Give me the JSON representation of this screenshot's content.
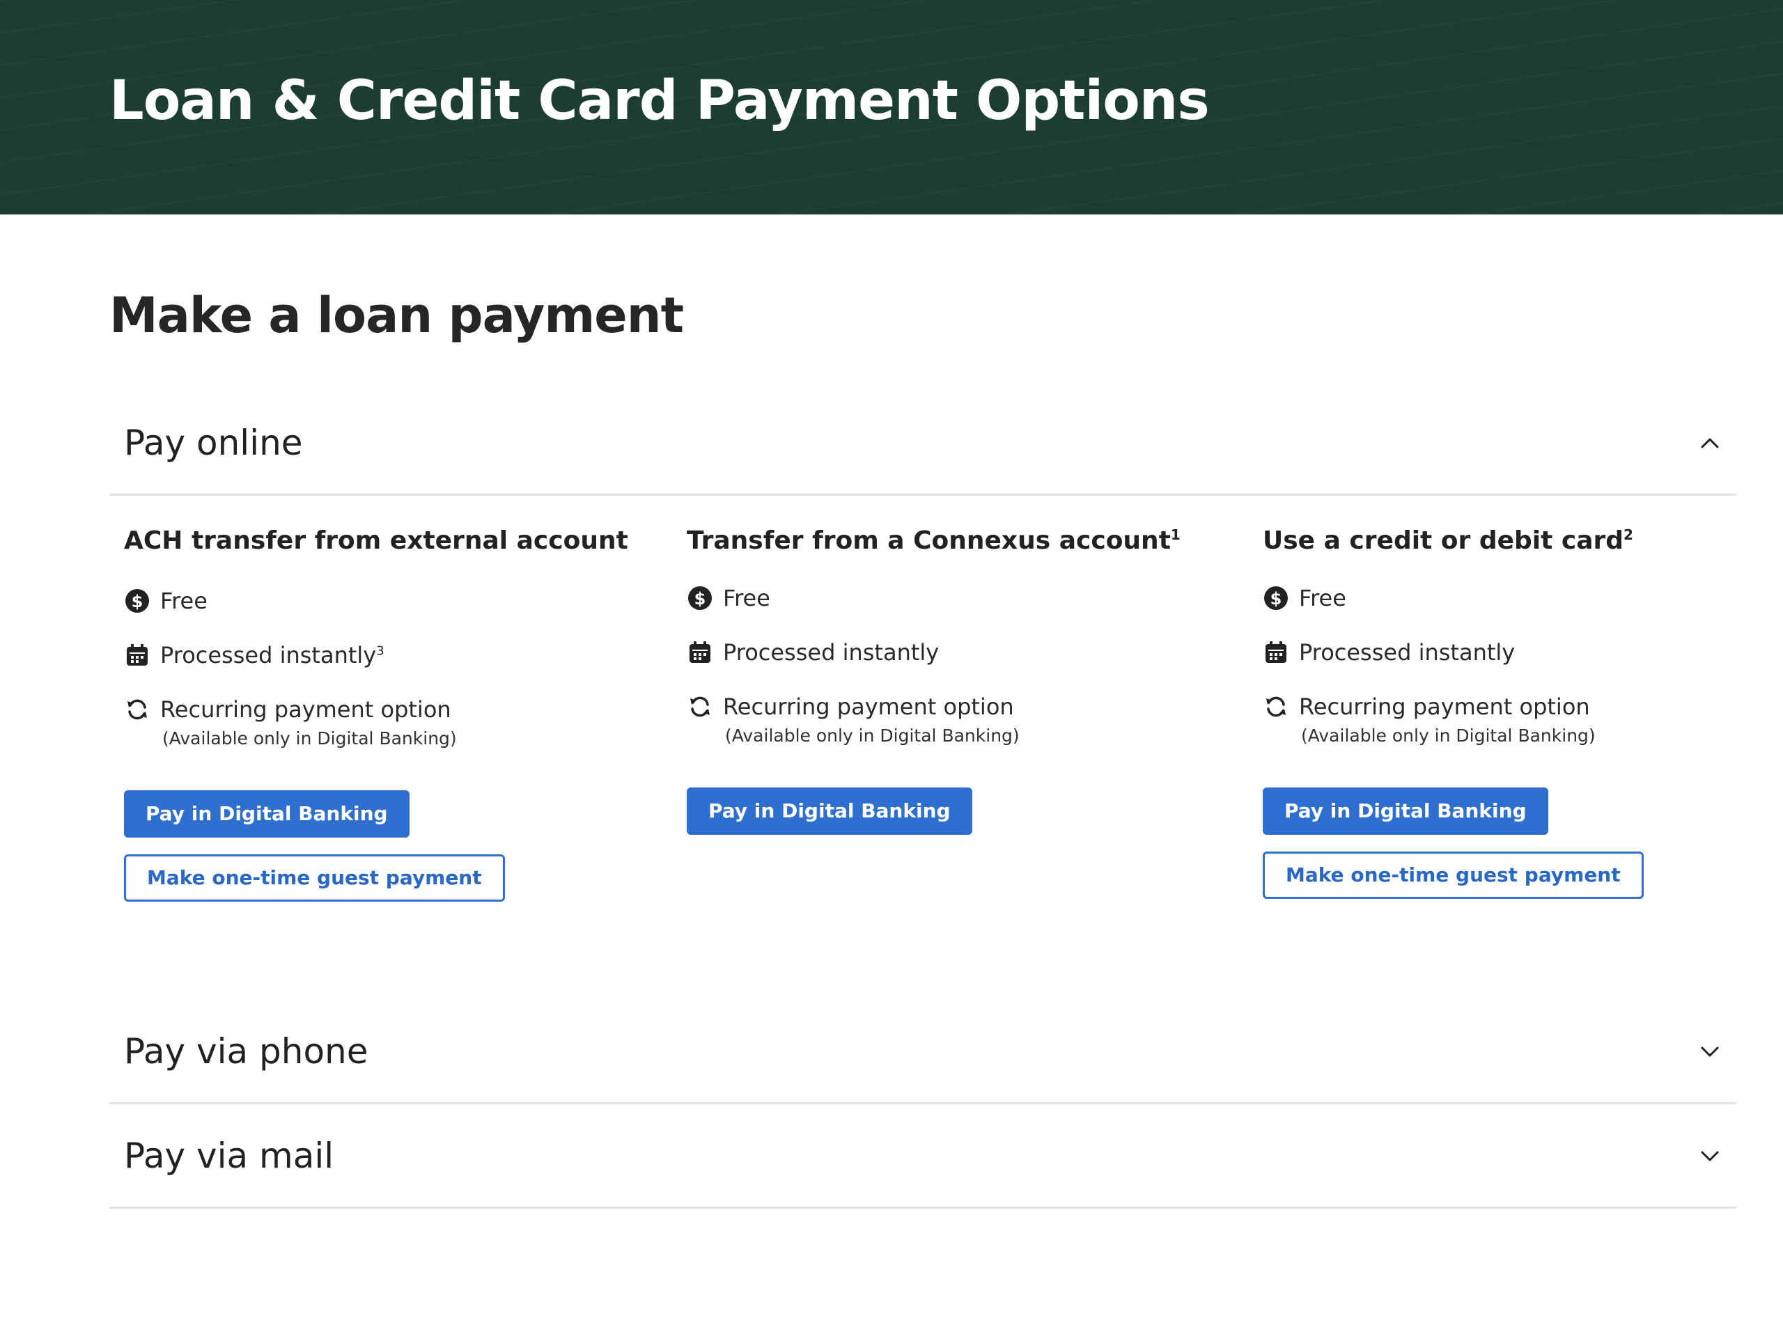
{
  "hero": {
    "title": "Loan & Credit Card Payment Options"
  },
  "section": {
    "title": "Make a loan payment"
  },
  "accordions": {
    "online": {
      "label": "Pay online",
      "state": "expanded"
    },
    "phone": {
      "label": "Pay via phone",
      "state": "collapsed"
    },
    "mail": {
      "label": "Pay via mail",
      "state": "collapsed"
    }
  },
  "options": [
    {
      "title": "ACH transfer from external account",
      "title_sup": "",
      "free": "Free",
      "processed": "Processed instantly",
      "processed_sup": "3",
      "recurring": "Recurring payment option",
      "recurring_note": "(Available only in Digital Banking)",
      "primary_button": "Pay in Digital Banking",
      "guest_button": "Make one-time guest payment"
    },
    {
      "title": "Transfer from a Connexus account",
      "title_sup": "1",
      "free": "Free",
      "processed": "Processed instantly",
      "processed_sup": "",
      "recurring": "Recurring payment option",
      "recurring_note": "(Available only in Digital Banking)",
      "primary_button": "Pay in Digital Banking"
    },
    {
      "title": "Use a credit or debit card",
      "title_sup": "2",
      "free": "Free",
      "processed": "Processed instantly",
      "processed_sup": "",
      "recurring": "Recurring payment option",
      "recurring_note": "(Available only in Digital Banking)",
      "primary_button": "Pay in Digital Banking",
      "guest_button": "Make one-time guest payment"
    }
  ],
  "icons": {
    "free": "dollar-circle-icon",
    "processed": "calendar-icon",
    "recurring": "refresh-icon",
    "expanded": "chevron-up-icon",
    "collapsed": "chevron-down-icon"
  },
  "colors": {
    "hero_bg": "#1b3d34",
    "primary": "#2f6fcf",
    "text": "#222222",
    "divider": "#e3e3e3"
  }
}
